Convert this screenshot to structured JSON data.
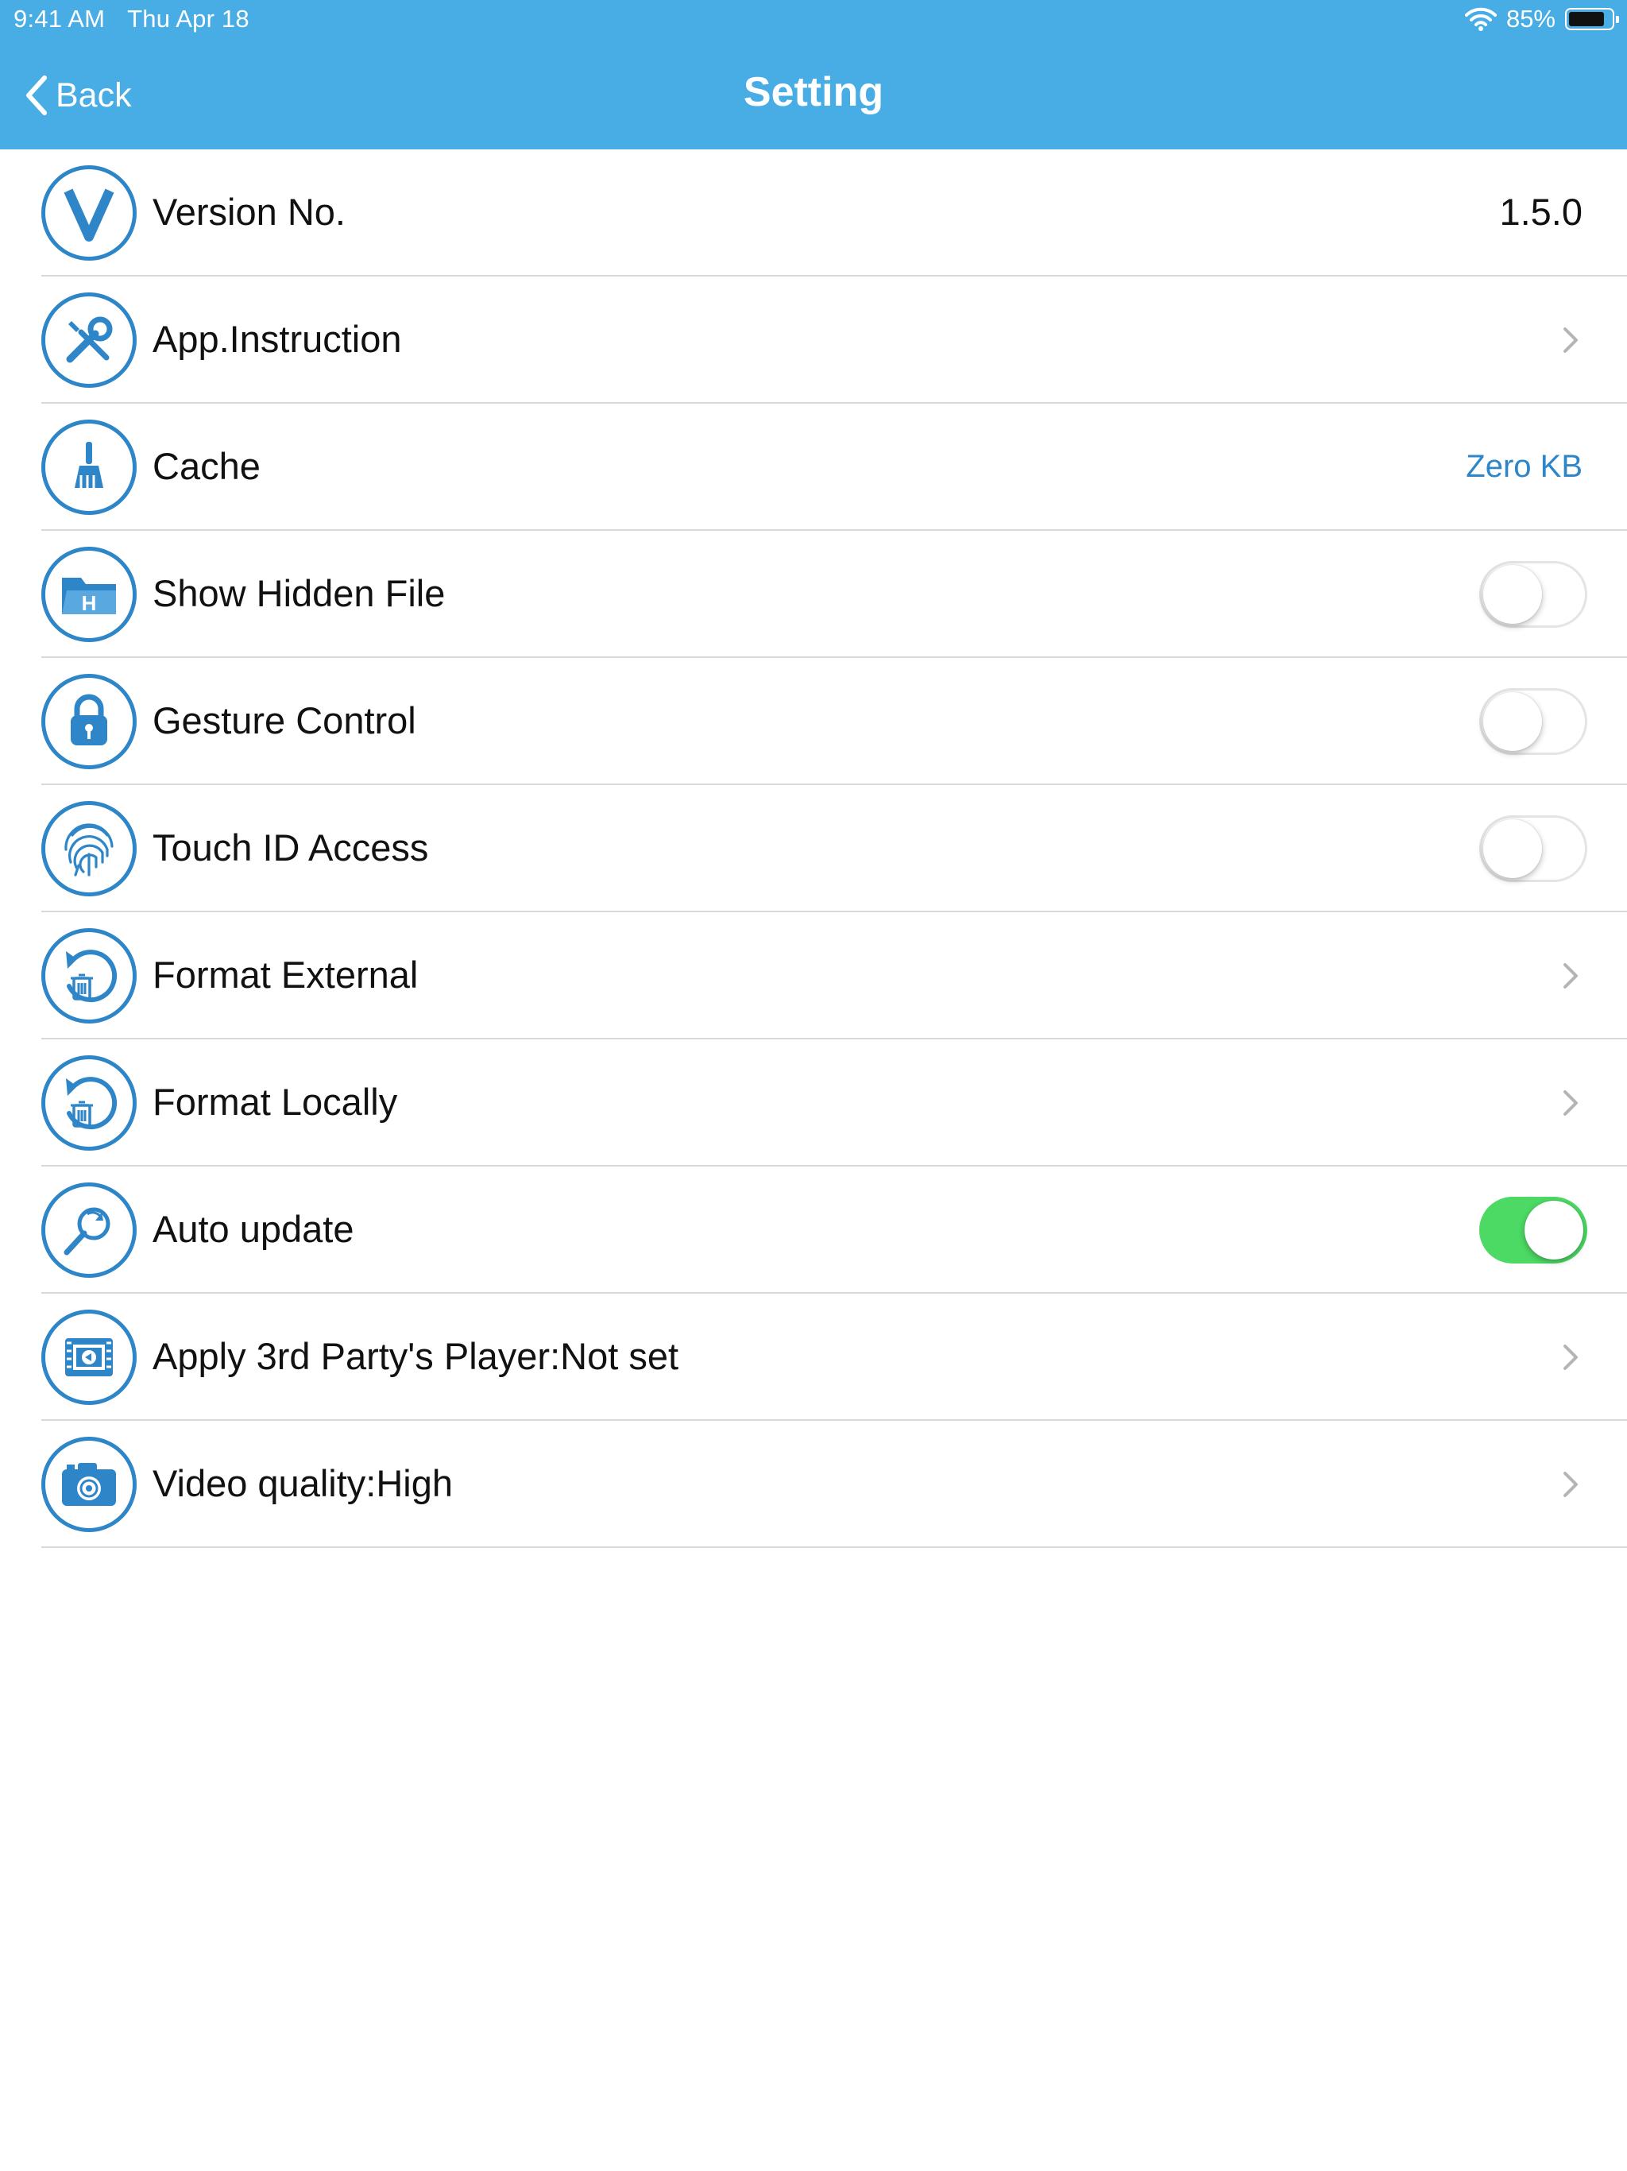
{
  "status_bar": {
    "time": "9:41 AM",
    "date": "Thu Apr 18",
    "battery": "85%",
    "battery_level": 0.85
  },
  "nav": {
    "back_label": "Back",
    "title": "Setting"
  },
  "colors": {
    "header": "#47ade4",
    "accent": "#2e86c8",
    "toggle_on": "#4cd964"
  },
  "rows": [
    {
      "label": "Version No.",
      "value": "1.5.0",
      "icon": "version-v-icon"
    },
    {
      "label": "App.Instruction",
      "icon": "tools-icon",
      "accessory": "chevron"
    },
    {
      "label": "Cache",
      "value": "Zero KB",
      "icon": "broom-icon"
    },
    {
      "label": "Show Hidden File",
      "icon": "hidden-folder-icon",
      "toggle": false
    },
    {
      "label": "Gesture Control",
      "icon": "lock-icon",
      "toggle": false
    },
    {
      "label": "Touch ID Access",
      "icon": "fingerprint-icon",
      "toggle": false
    },
    {
      "label": "Format External",
      "icon": "format-trash-icon",
      "accessory": "chevron"
    },
    {
      "label": "Format Locally",
      "icon": "format-trash-icon",
      "accessory": "chevron"
    },
    {
      "label": "Auto update",
      "icon": "magnifier-refresh-icon",
      "toggle": true
    },
    {
      "label": "Apply 3rd Party's Player:Not set",
      "icon": "video-player-icon",
      "accessory": "chevron"
    },
    {
      "label": "Video quality:High",
      "icon": "camera-icon",
      "accessory": "chevron"
    }
  ]
}
